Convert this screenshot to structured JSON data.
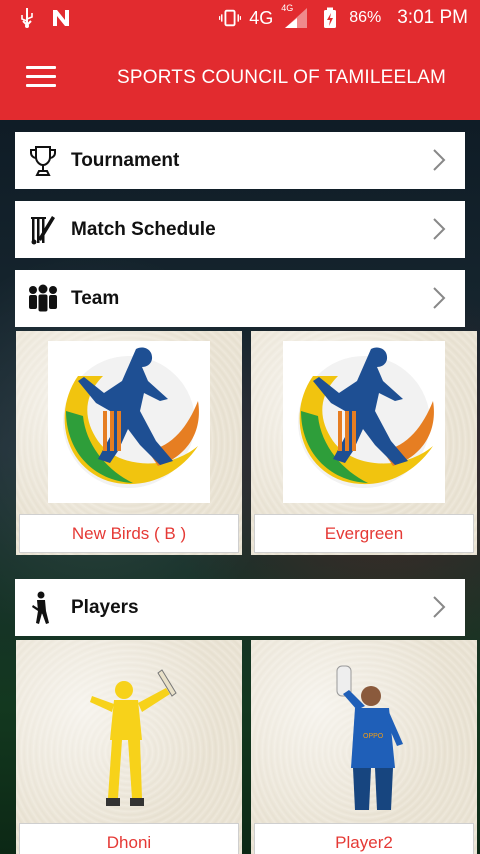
{
  "status_bar": {
    "network": "4G",
    "network_small": "4G",
    "battery": "86%",
    "time": "3:01 PM"
  },
  "app_bar": {
    "title": "SPORTS COUNCIL OF TAMILEELAM"
  },
  "menu": {
    "tournament": "Tournament",
    "match_schedule": "Match Schedule",
    "team": "Team",
    "players": "Players"
  },
  "teams": [
    {
      "name": "New Birds ( B )"
    },
    {
      "name": "Evergreen"
    }
  ],
  "players": [
    {
      "name": "Dhoni",
      "jersey_color": "#f7d21a"
    },
    {
      "name": "Player2",
      "jersey_color": "#1f5fb8"
    }
  ],
  "colors": {
    "brand": "#e22b2f",
    "label": "#e53935"
  }
}
